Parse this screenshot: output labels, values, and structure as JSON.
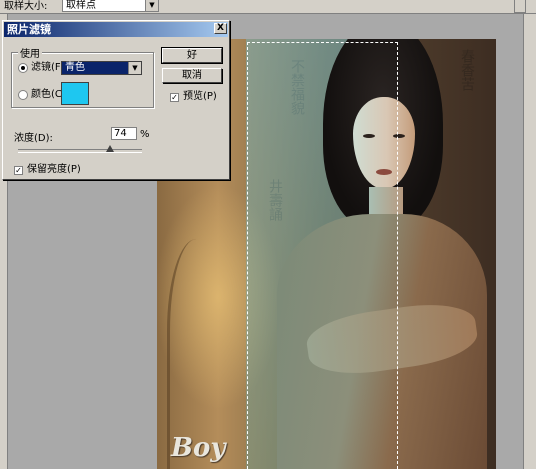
{
  "options_bar": {
    "sample_size_label": "取样大小:",
    "sample_size_value": "取样点"
  },
  "dialog": {
    "title": "照片滤镜",
    "close_glyph": "X",
    "use_group_label": "使用",
    "filter_label": "滤镜(F):",
    "filter_value": "青色",
    "color_label": "颜色(C):",
    "color_swatch": "#1ec7f0",
    "selected_option": "filter",
    "ok_label": "好",
    "cancel_label": "取消",
    "preview_label": "预览(P)",
    "preview_checked": true,
    "density_label": "浓度(D):",
    "density_value": "74",
    "density_unit": "%",
    "density_fraction": 0.74,
    "preserve_luminosity_label": "保留亮度(P)",
    "preserve_luminosity_checked": true
  },
  "photo": {
    "watermark": "Boy"
  },
  "icons": [
    "close-icon",
    "dropdown-arrow-icon",
    "checkmark-icon"
  ]
}
